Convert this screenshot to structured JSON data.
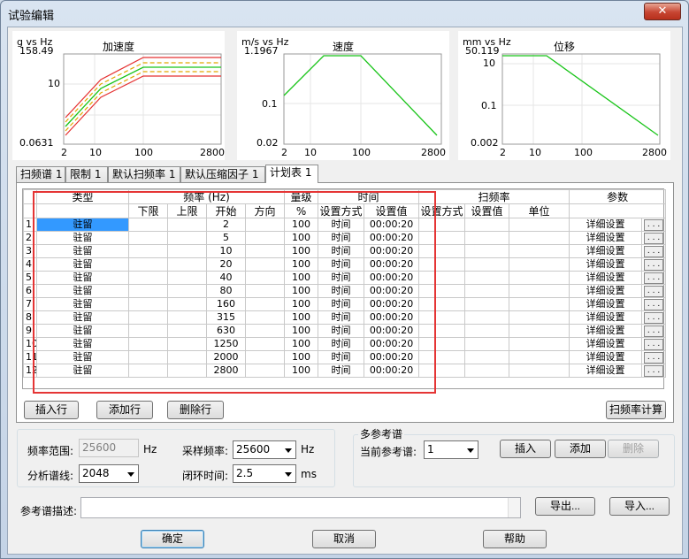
{
  "window": {
    "title": "试验编辑",
    "close_glyph": "✕"
  },
  "charts": [
    {
      "title": "加速度",
      "unit": "g vs Hz",
      "ymax": "158.49",
      "ymid": "10",
      "ymin": "0.0631",
      "x_ticks": [
        "2",
        "10",
        "100",
        "2800"
      ]
    },
    {
      "title": "速度",
      "unit": "m/s vs Hz",
      "ymax": "1.1967",
      "ymid": "0.1",
      "ymin": "0.02",
      "x_ticks": [
        "2",
        "10",
        "100",
        "2800"
      ]
    },
    {
      "title": "位移",
      "unit": "mm vs Hz",
      "ymax": "50.119",
      "ytop": "10",
      "ymid": "0.1",
      "ymin": "0.002",
      "x_ticks": [
        "2",
        "10",
        "100",
        "2800"
      ]
    }
  ],
  "tabs": [
    "扫频谱 1",
    "限制 1",
    "默认扫频率 1",
    "默认压缩因子 1",
    "计划表 1"
  ],
  "table": {
    "group_headers": {
      "type": "类型",
      "freq": "频率 (Hz)",
      "level": "量级",
      "time": "时间",
      "sweep": "扫频率",
      "params": "参数"
    },
    "sub_headers": {
      "lower": "下限",
      "upper": "上限",
      "start": "开始",
      "direction": "方向",
      "percent": "%",
      "time_mode": "设置方式",
      "time_value": "设置值",
      "sweep_mode": "设置方式",
      "sweep_value": "设置值",
      "sweep_unit": "单位"
    },
    "rows": [
      {
        "n": "1",
        "type": "驻留",
        "start": "2",
        "level": "100",
        "mode": "时间",
        "value": "00:00:20",
        "detail": "详细设置"
      },
      {
        "n": "2",
        "type": "驻留",
        "start": "5",
        "level": "100",
        "mode": "时间",
        "value": "00:00:20",
        "detail": "详细设置"
      },
      {
        "n": "3",
        "type": "驻留",
        "start": "10",
        "level": "100",
        "mode": "时间",
        "value": "00:00:20",
        "detail": "详细设置"
      },
      {
        "n": "4",
        "type": "驻留",
        "start": "20",
        "level": "100",
        "mode": "时间",
        "value": "00:00:20",
        "detail": "详细设置"
      },
      {
        "n": "5",
        "type": "驻留",
        "start": "40",
        "level": "100",
        "mode": "时间",
        "value": "00:00:20",
        "detail": "详细设置"
      },
      {
        "n": "6",
        "type": "驻留",
        "start": "80",
        "level": "100",
        "mode": "时间",
        "value": "00:00:20",
        "detail": "详细设置"
      },
      {
        "n": "7",
        "type": "驻留",
        "start": "160",
        "level": "100",
        "mode": "时间",
        "value": "00:00:20",
        "detail": "详细设置"
      },
      {
        "n": "8",
        "type": "驻留",
        "start": "315",
        "level": "100",
        "mode": "时间",
        "value": "00:00:20",
        "detail": "详细设置"
      },
      {
        "n": "9",
        "type": "驻留",
        "start": "630",
        "level": "100",
        "mode": "时间",
        "value": "00:00:20",
        "detail": "详细设置"
      },
      {
        "n": "10",
        "type": "驻留",
        "start": "1250",
        "level": "100",
        "mode": "时间",
        "value": "00:00:20",
        "detail": "详细设置"
      },
      {
        "n": "11",
        "type": "驻留",
        "start": "2000",
        "level": "100",
        "mode": "时间",
        "value": "00:00:20",
        "detail": "详细设置"
      },
      {
        "n": "12",
        "type": "驻留",
        "start": "2800",
        "level": "100",
        "mode": "时间",
        "value": "00:00:20",
        "detail": "详细设置"
      }
    ],
    "dots_label": ". . ."
  },
  "buttons": {
    "insert_row": "插入行",
    "add_row": "添加行",
    "delete_row": "删除行",
    "sweep_calc": "扫频率计算",
    "insert": "插入",
    "add": "添加",
    "delete": "删除",
    "export": "导出...",
    "import": "导入...",
    "ok": "确定",
    "cancel": "取消",
    "help": "帮助"
  },
  "settings": {
    "freq_range_label": "频率范围:",
    "freq_range_value": "25600",
    "hz1": "Hz",
    "lines_label": "分析谱线:",
    "lines_value": "2048",
    "sample_label": "采样频率:",
    "sample_value": "25600",
    "hz2": "Hz",
    "loop_label": "闭环时间:",
    "loop_value": "2.5",
    "ms": "ms"
  },
  "multi_ref": {
    "title": "多参考谱",
    "current_label": "当前参考谱:",
    "current_value": "1"
  },
  "ref_desc_label": "参考谱描述:"
}
